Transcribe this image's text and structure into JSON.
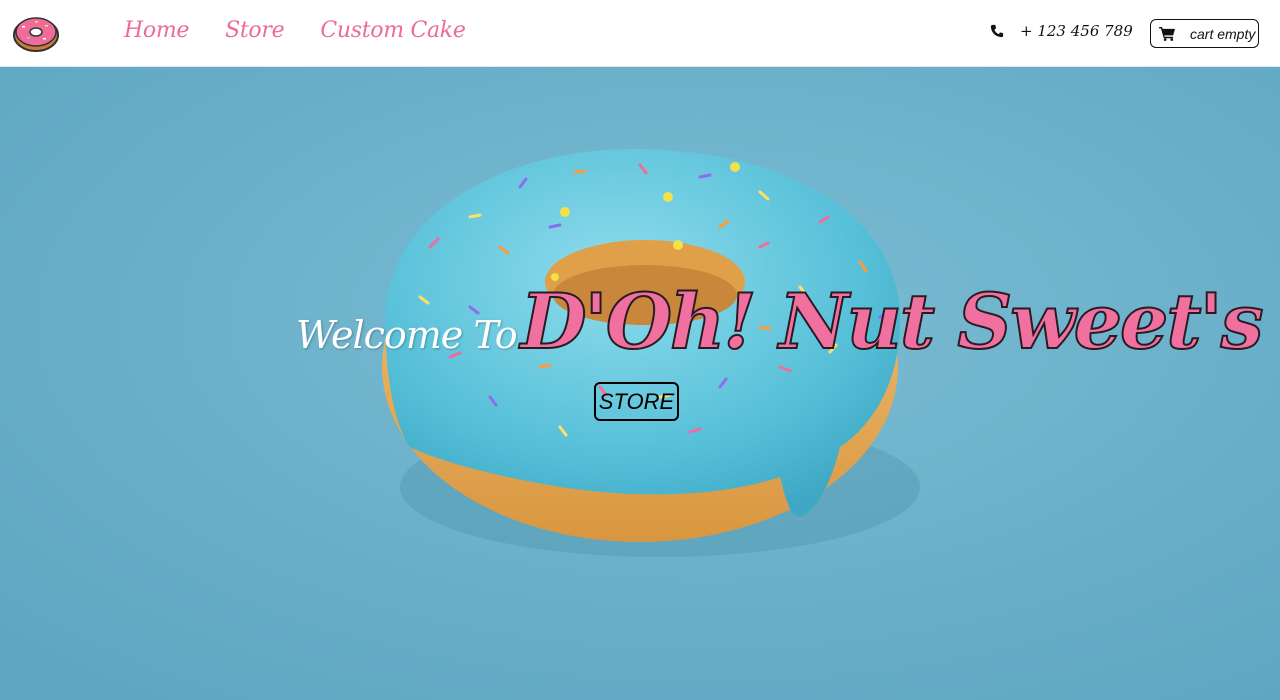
{
  "nav": {
    "logo_icon": "donut-icon",
    "links": [
      {
        "label": "Home"
      },
      {
        "label": "Store"
      },
      {
        "label": "Custom Cake"
      }
    ],
    "phone_icon": "phone-icon",
    "phone": "+ 123 456 789",
    "cart_icon": "cart-icon",
    "cart_label": "cart empty"
  },
  "hero": {
    "welcome": "Welcome To",
    "brand": "D'Oh! Nut Sweet's",
    "store_button": "STORE"
  },
  "colors": {
    "accent_pink": "#ee6b96",
    "hero_bg": "#6cb0cb",
    "icing": "#63c6dc"
  }
}
